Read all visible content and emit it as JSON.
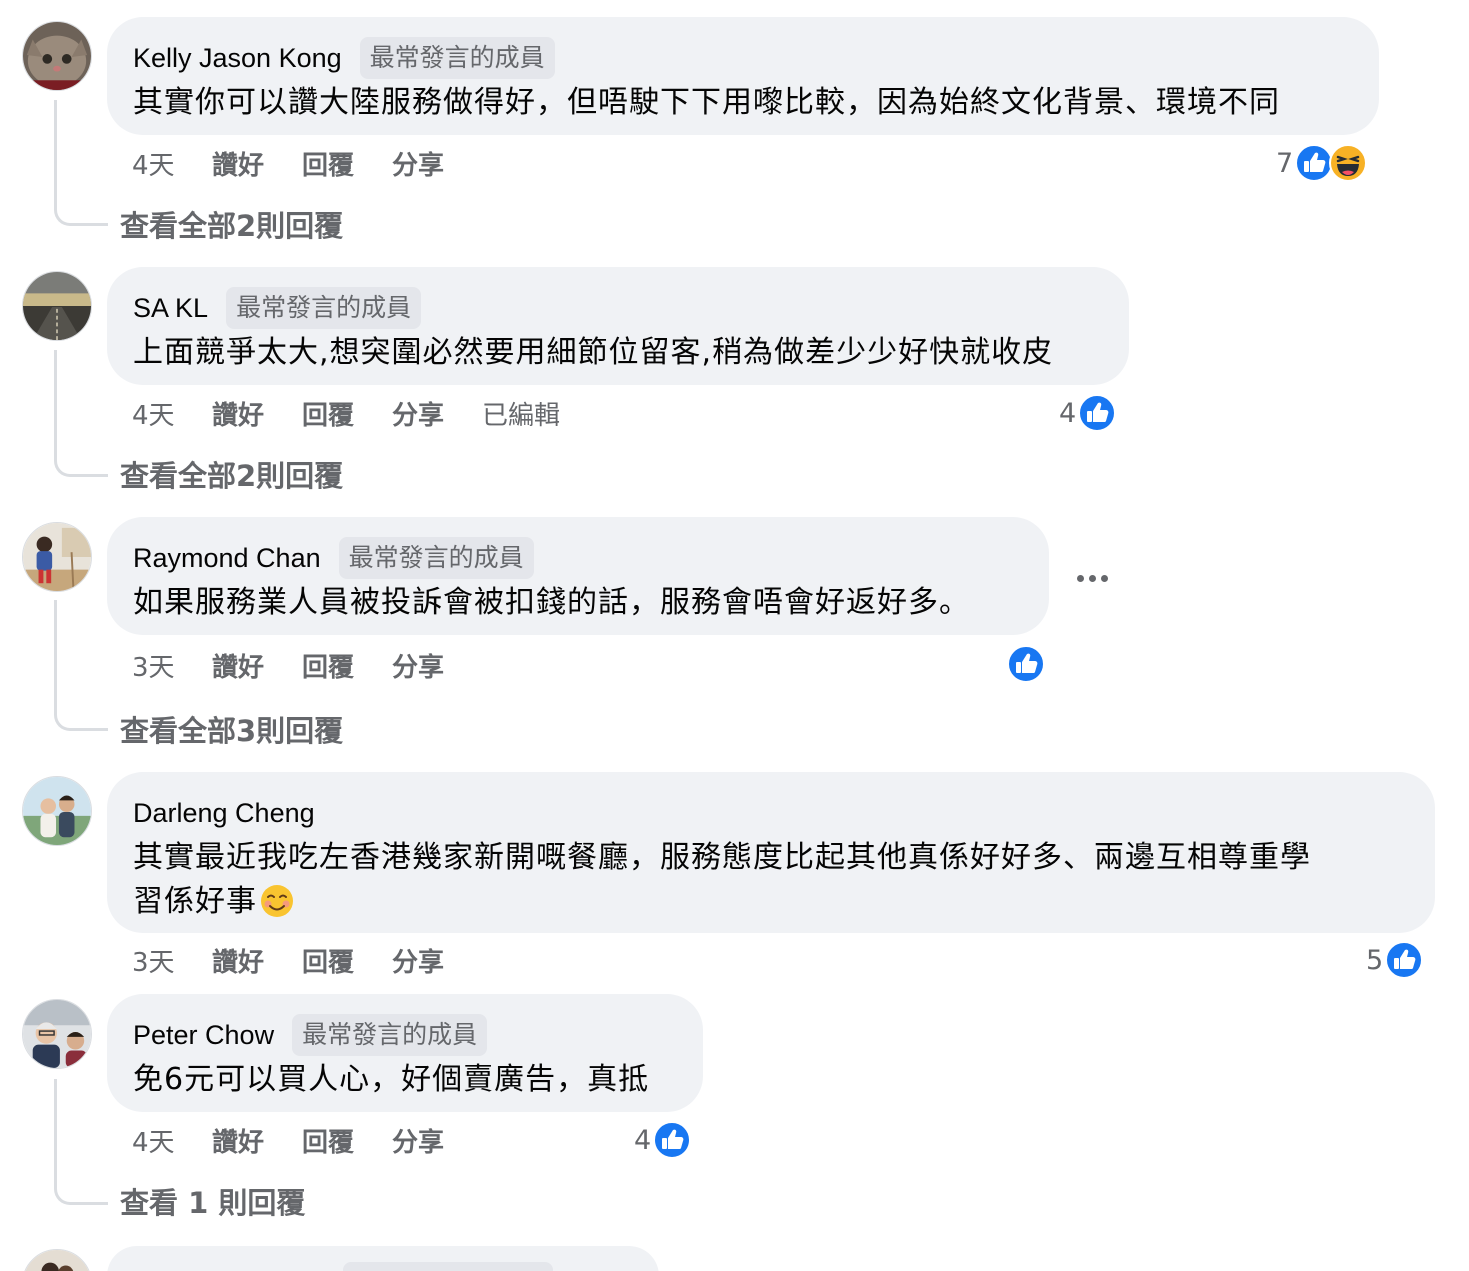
{
  "comments": [
    {
      "author": "Kelly Jason Kong",
      "badge": "最常發言的成員",
      "text": "其實你可以讚大陸服務做得好，但唔駛下下用嚟比較，因為始終文化背景、環境不同",
      "time": "4天",
      "like": "讚好",
      "reply": "回覆",
      "share": "分享",
      "reaction_count": "7",
      "reactions": [
        "like-icon",
        "haha-icon"
      ],
      "view_replies": "查看全部2則回覆",
      "avatar": "cat-avatar"
    },
    {
      "author": "SA KL",
      "badge": "最常發言的成員",
      "text": "上面競爭太大,想突圍必然要用細節位留客,稍為做差少少好快就收皮",
      "time": "4天",
      "like": "讚好",
      "reply": "回覆",
      "share": "分享",
      "edited": "已編輯",
      "reaction_count": "4",
      "reactions": [
        "like-icon"
      ],
      "view_replies": "查看全部2則回覆",
      "avatar": "road-avatar"
    },
    {
      "author": "Raymond Chan",
      "badge": "最常發言的成員",
      "text": "如果服務業人員被投訴會被扣錢的話，服務會唔會好返好多。",
      "time": "3天",
      "like": "讚好",
      "reply": "回覆",
      "share": "分享",
      "reaction_count": "",
      "reactions": [
        "like-icon"
      ],
      "view_replies": "查看全部3則回覆",
      "avatar": "child-avatar"
    },
    {
      "author": "Darleng Cheng",
      "badge": "",
      "text_line1": "其實最近我吃左香港幾家新開嘅餐廳，服務態度比起其他真係好好多、兩邊互相尊重學",
      "text_line2": "習係好事",
      "text_emoji": "smiling-face-emoji",
      "time": "3天",
      "like": "讚好",
      "reply": "回覆",
      "share": "分享",
      "reaction_count": "5",
      "reactions": [
        "like-icon"
      ],
      "avatar": "couple-avatar"
    },
    {
      "author": "Peter Chow",
      "badge": "最常發言的成員",
      "text": "免6元可以買人心，好個賣廣告，真抵",
      "time": "4天",
      "like": "讚好",
      "reply": "回覆",
      "share": "分享",
      "reaction_count": "4",
      "reactions": [
        "like-icon"
      ],
      "view_replies": "查看 1 則回覆",
      "avatar": "peter-avatar"
    }
  ],
  "colors": {
    "bubble": "#f0f2f5",
    "badge": "#e4e6eb",
    "secondary_text": "#65676b",
    "like_blue": "#1877f2",
    "haha_yellow": "#f7b125"
  }
}
